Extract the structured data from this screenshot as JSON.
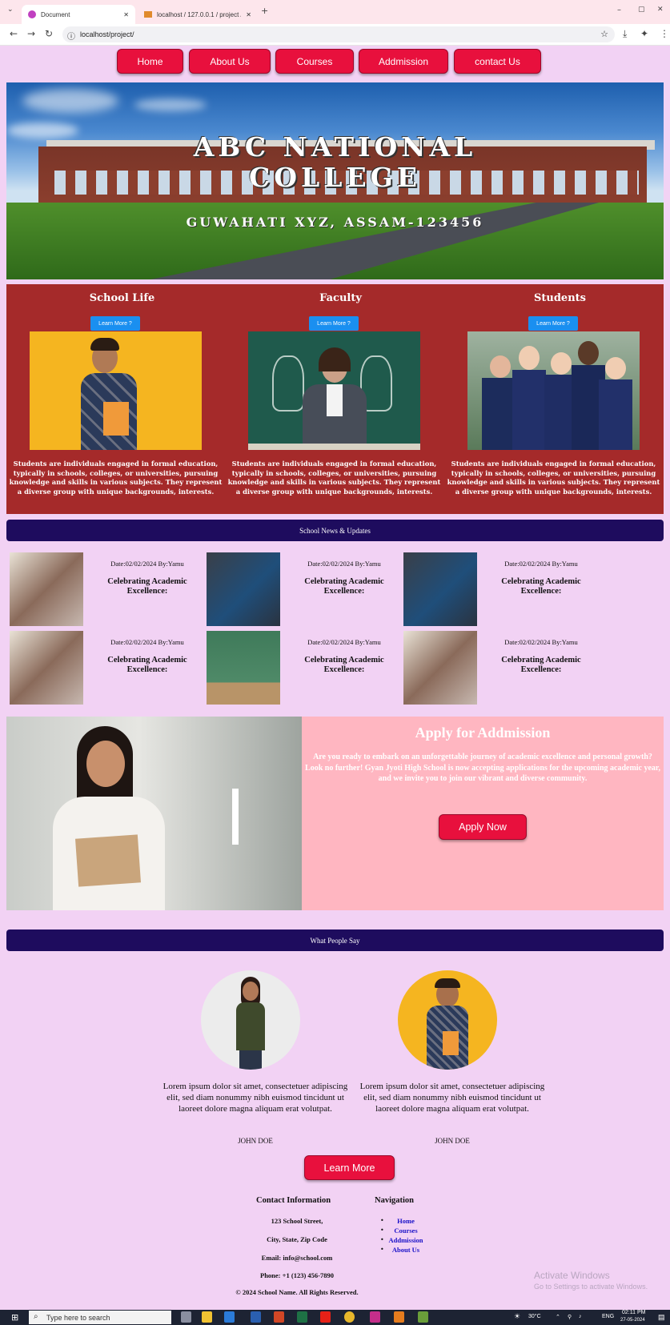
{
  "browser": {
    "tabs": [
      {
        "label": "Document",
        "close": "✕"
      },
      {
        "label": "localhost / 127.0.0.1 / project /",
        "close": "✕"
      }
    ],
    "new_tab": "+",
    "window_controls": [
      "–",
      "▢",
      "✕"
    ],
    "address": "localhost/project/",
    "nav_icons": [
      "back-icon",
      "forward-icon",
      "reload-icon",
      "site-info-icon",
      "star-icon",
      "download-icon",
      "extension-icon",
      "menu-icon"
    ]
  },
  "nav": [
    "Home",
    "About Us",
    "Courses",
    "Addmission",
    "contact Us"
  ],
  "hero": {
    "title_line1": "ABC NATIONAL",
    "title_line2": "COLLEGE",
    "subtitle": "GUWAHATI XYZ, ASSAM-123456"
  },
  "features": [
    {
      "title": "School Life",
      "button": "Learn More ?",
      "text": "Students are individuals engaged in formal education, typically in schools, colleges, or universities, pursuing knowledge and skills in various subjects. They represent a diverse group with unique backgrounds, interests."
    },
    {
      "title": "Faculty",
      "button": "Learn More ?",
      "text": "Students are individuals engaged in formal education, typically in schools, colleges, or universities, pursuing knowledge and skills in various subjects. They represent a diverse group with unique backgrounds, interests."
    },
    {
      "title": "Students",
      "button": "Learn More ?",
      "text": "Students are individuals engaged in formal education, typically in schools, colleges, or universities, pursuing knowledge and skills in various subjects. They represent a diverse group with unique backgrounds, interests."
    }
  ],
  "news": {
    "heading": "School News & Updates",
    "items": [
      {
        "date": "Date:02/02/2024 By:Yamu",
        "title": "Celebrating Academic Excellence:"
      },
      {
        "date": "Date:02/02/2024 By:Yamu",
        "title": "Celebrating Academic Excellence:"
      },
      {
        "date": "Date:02/02/2024 By:Yamu",
        "title": "Celebrating Academic Excellence:"
      },
      {
        "date": "Date:02/02/2024 By:Yamu",
        "title": "Celebrating Academic Excellence:"
      },
      {
        "date": "Date:02/02/2024 By:Yamu",
        "title": "Celebrating Academic Excellence:"
      },
      {
        "date": "Date:02/02/2024 By:Yamu",
        "title": "Celebrating Academic Excellence:"
      }
    ]
  },
  "admission": {
    "title": "Apply for Addmission",
    "text": "Are you ready to embark on an unforgettable journey of academic excellence and personal growth? Look no further! Gyan Jyoti High School is now accepting applications for the upcoming academic year, and we invite you to join our vibrant and diverse community.",
    "button": "Apply Now"
  },
  "testimonials": {
    "heading": "What People Say",
    "items": [
      {
        "quote": "Lorem ipsum dolor sit amet, consectetuer adipiscing elit, sed diam nonummy nibh euismod tincidunt ut laoreet dolore magna aliquam erat volutpat.",
        "name": "JOHN DOE"
      },
      {
        "quote": "Lorem ipsum dolor sit amet, consectetuer adipiscing elit, sed diam nonummy nibh euismod tincidunt ut laoreet dolore magna aliquam erat volutpat.",
        "name": "JOHN DOE"
      }
    ],
    "button": "Learn More"
  },
  "footer": {
    "contact_title": "Contact Information",
    "contact_lines": [
      "123 School Street,",
      "City, State, Zip Code",
      "Email: info@school.com",
      "Phone: +1 (123) 456-7890"
    ],
    "nav_title": "Navigation",
    "nav_links": [
      "Home",
      "Courses",
      "Addmission",
      "About Us"
    ],
    "copyright": "© 2024 School Name. All Rights Reserved."
  },
  "watermark": {
    "line1": "Activate Windows",
    "line2": "Go to Settings to activate Windows."
  },
  "taskbar": {
    "search_placeholder": "Type here to search",
    "temperature": "30°C",
    "language": "ENG",
    "time": "02:11 PM",
    "date": "27-05-2024"
  },
  "colors": {
    "accent_red": "#e8103d",
    "section_red": "#a52a2a",
    "banner_navy": "#1e0c5e",
    "page_bg": "#f2d2f4",
    "admission_pink": "#ffb6c1",
    "learn_blue": "#1a8ff0"
  }
}
